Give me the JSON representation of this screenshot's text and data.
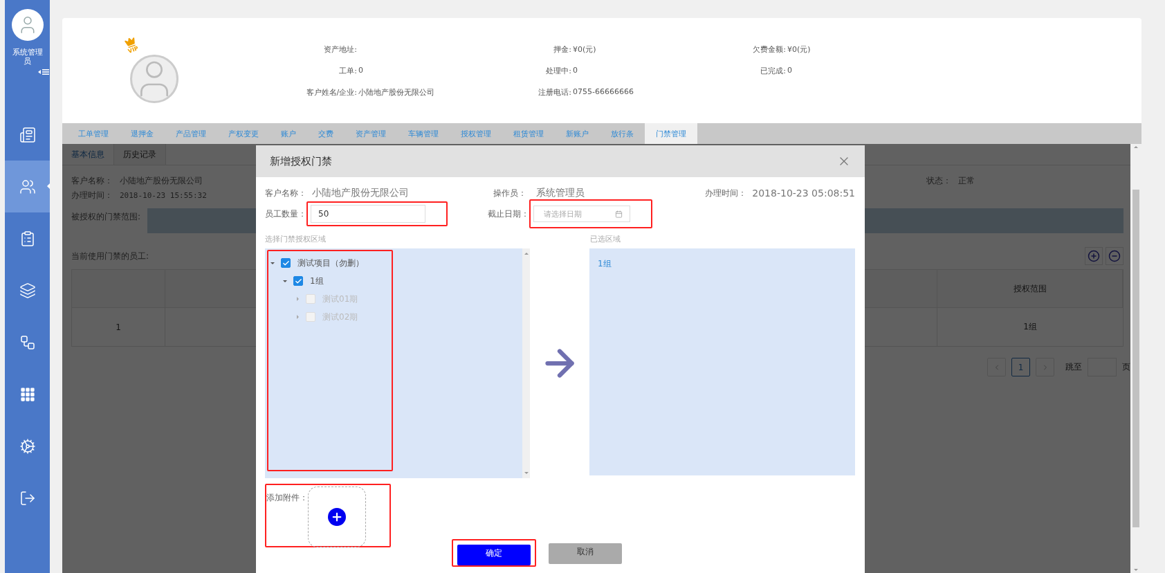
{
  "sidebar": {
    "user_name": "系统管理员",
    "nav": [
      {
        "selected": false
      },
      {
        "selected": true
      },
      {
        "selected": false
      },
      {
        "selected": false
      },
      {
        "selected": false
      },
      {
        "selected": false
      },
      {
        "selected": false
      },
      {
        "selected": false
      }
    ]
  },
  "header": {
    "vip_badge": "VIP",
    "info_columns": [
      [
        {
          "label": "资产地址:"
        },
        {
          "label": "工单:",
          "value": "0"
        },
        {
          "label": "客户姓名/企业:",
          "value": "小陆地产股份无限公司"
        }
      ],
      [
        {
          "label": "押金:",
          "value": "¥0(元)"
        },
        {
          "label": "处理中:",
          "value": "0"
        },
        {
          "label": "注册电话:",
          "value": "0755-66666666"
        }
      ],
      [
        {
          "label": "欠费金额:",
          "value": "¥0(元)"
        },
        {
          "label": "已完成:",
          "value": "0"
        }
      ]
    ]
  },
  "tabs": [
    {
      "label": "工单管理",
      "selected": false
    },
    {
      "label": "退押金",
      "selected": false
    },
    {
      "label": "产品管理",
      "selected": false
    },
    {
      "label": "产权变更",
      "selected": false
    },
    {
      "label": "账户",
      "selected": false
    },
    {
      "label": "交费",
      "selected": false
    },
    {
      "label": "资产管理",
      "selected": false
    },
    {
      "label": "车辆管理",
      "selected": false
    },
    {
      "label": "授权管理",
      "selected": false
    },
    {
      "label": "租赁管理",
      "selected": false
    },
    {
      "label": "新账户",
      "selected": false
    },
    {
      "label": "放行条",
      "selected": false
    },
    {
      "label": "门禁管理",
      "selected": true
    }
  ],
  "content": {
    "tabs": [
      {
        "label": "基本信息",
        "selected": true
      },
      {
        "label": "历史记录",
        "selected": false
      }
    ],
    "customer_label": "客户名称：",
    "customer": "小陆地产股份无限公司",
    "time_label": "办理时间：",
    "time": "2018-10-23 15:55:32",
    "status_label": "状态：",
    "status": "正常",
    "scope_label": "被授权的门禁范围:",
    "staff_label": "当前使用门禁的员工:",
    "table": {
      "scope_header": "授权范围",
      "rows": [
        {
          "index": "1",
          "scope": "1组"
        }
      ]
    },
    "pagination": {
      "pages": [
        {
          "label": "1",
          "selected": true
        }
      ],
      "jump_label": "跳至",
      "page_suffix": "页"
    }
  },
  "modal": {
    "title": "新增授权门禁",
    "customer_label": "客户名称：",
    "customer": "小陆地产股份无限公司",
    "operator_label": "操作员：",
    "operator": "系统管理员",
    "time_label": "办理时间：",
    "time": "2018-10-23 05:08:51",
    "staff_count_label": "员工数量：",
    "staff_count": "50",
    "deadline_label": "截止日期：",
    "deadline_placeholder": "请选择日期",
    "tree_label": "选择门禁授权区域",
    "selected_label": "已选区域",
    "tree": [
      {
        "label": "测试项目（勿删）",
        "checked": true,
        "expanded": true,
        "disabled": false,
        "children": [
          {
            "label": "1组",
            "checked": true,
            "expanded": true,
            "disabled": false,
            "children": [
              {
                "label": "测试01期",
                "checked": false,
                "expanded": false,
                "disabled": true
              },
              {
                "label": "测试02期",
                "checked": false,
                "expanded": false,
                "disabled": true
              }
            ]
          }
        ]
      }
    ],
    "selected_items": [
      "1组"
    ],
    "attachment_label": "添加附件：",
    "confirm": "确定",
    "cancel": "取消"
  }
}
